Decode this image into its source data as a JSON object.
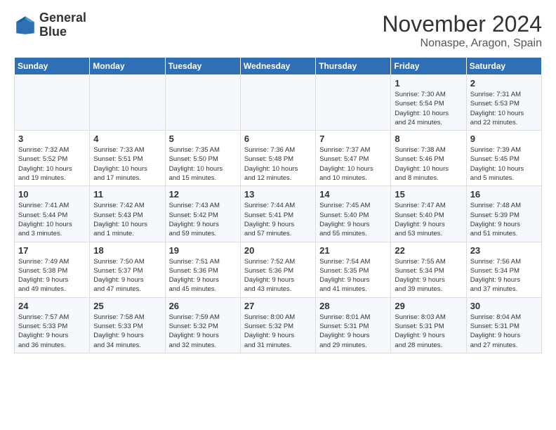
{
  "header": {
    "logo_line1": "General",
    "logo_line2": "Blue",
    "month": "November 2024",
    "location": "Nonaspe, Aragon, Spain"
  },
  "weekdays": [
    "Sunday",
    "Monday",
    "Tuesday",
    "Wednesday",
    "Thursday",
    "Friday",
    "Saturday"
  ],
  "weeks": [
    [
      {
        "day": "",
        "info": ""
      },
      {
        "day": "",
        "info": ""
      },
      {
        "day": "",
        "info": ""
      },
      {
        "day": "",
        "info": ""
      },
      {
        "day": "",
        "info": ""
      },
      {
        "day": "1",
        "info": "Sunrise: 7:30 AM\nSunset: 5:54 PM\nDaylight: 10 hours\nand 24 minutes."
      },
      {
        "day": "2",
        "info": "Sunrise: 7:31 AM\nSunset: 5:53 PM\nDaylight: 10 hours\nand 22 minutes."
      }
    ],
    [
      {
        "day": "3",
        "info": "Sunrise: 7:32 AM\nSunset: 5:52 PM\nDaylight: 10 hours\nand 19 minutes."
      },
      {
        "day": "4",
        "info": "Sunrise: 7:33 AM\nSunset: 5:51 PM\nDaylight: 10 hours\nand 17 minutes."
      },
      {
        "day": "5",
        "info": "Sunrise: 7:35 AM\nSunset: 5:50 PM\nDaylight: 10 hours\nand 15 minutes."
      },
      {
        "day": "6",
        "info": "Sunrise: 7:36 AM\nSunset: 5:48 PM\nDaylight: 10 hours\nand 12 minutes."
      },
      {
        "day": "7",
        "info": "Sunrise: 7:37 AM\nSunset: 5:47 PM\nDaylight: 10 hours\nand 10 minutes."
      },
      {
        "day": "8",
        "info": "Sunrise: 7:38 AM\nSunset: 5:46 PM\nDaylight: 10 hours\nand 8 minutes."
      },
      {
        "day": "9",
        "info": "Sunrise: 7:39 AM\nSunset: 5:45 PM\nDaylight: 10 hours\nand 5 minutes."
      }
    ],
    [
      {
        "day": "10",
        "info": "Sunrise: 7:41 AM\nSunset: 5:44 PM\nDaylight: 10 hours\nand 3 minutes."
      },
      {
        "day": "11",
        "info": "Sunrise: 7:42 AM\nSunset: 5:43 PM\nDaylight: 10 hours\nand 1 minute."
      },
      {
        "day": "12",
        "info": "Sunrise: 7:43 AM\nSunset: 5:42 PM\nDaylight: 9 hours\nand 59 minutes."
      },
      {
        "day": "13",
        "info": "Sunrise: 7:44 AM\nSunset: 5:41 PM\nDaylight: 9 hours\nand 57 minutes."
      },
      {
        "day": "14",
        "info": "Sunrise: 7:45 AM\nSunset: 5:40 PM\nDaylight: 9 hours\nand 55 minutes."
      },
      {
        "day": "15",
        "info": "Sunrise: 7:47 AM\nSunset: 5:40 PM\nDaylight: 9 hours\nand 53 minutes."
      },
      {
        "day": "16",
        "info": "Sunrise: 7:48 AM\nSunset: 5:39 PM\nDaylight: 9 hours\nand 51 minutes."
      }
    ],
    [
      {
        "day": "17",
        "info": "Sunrise: 7:49 AM\nSunset: 5:38 PM\nDaylight: 9 hours\nand 49 minutes."
      },
      {
        "day": "18",
        "info": "Sunrise: 7:50 AM\nSunset: 5:37 PM\nDaylight: 9 hours\nand 47 minutes."
      },
      {
        "day": "19",
        "info": "Sunrise: 7:51 AM\nSunset: 5:36 PM\nDaylight: 9 hours\nand 45 minutes."
      },
      {
        "day": "20",
        "info": "Sunrise: 7:52 AM\nSunset: 5:36 PM\nDaylight: 9 hours\nand 43 minutes."
      },
      {
        "day": "21",
        "info": "Sunrise: 7:54 AM\nSunset: 5:35 PM\nDaylight: 9 hours\nand 41 minutes."
      },
      {
        "day": "22",
        "info": "Sunrise: 7:55 AM\nSunset: 5:34 PM\nDaylight: 9 hours\nand 39 minutes."
      },
      {
        "day": "23",
        "info": "Sunrise: 7:56 AM\nSunset: 5:34 PM\nDaylight: 9 hours\nand 37 minutes."
      }
    ],
    [
      {
        "day": "24",
        "info": "Sunrise: 7:57 AM\nSunset: 5:33 PM\nDaylight: 9 hours\nand 36 minutes."
      },
      {
        "day": "25",
        "info": "Sunrise: 7:58 AM\nSunset: 5:33 PM\nDaylight: 9 hours\nand 34 minutes."
      },
      {
        "day": "26",
        "info": "Sunrise: 7:59 AM\nSunset: 5:32 PM\nDaylight: 9 hours\nand 32 minutes."
      },
      {
        "day": "27",
        "info": "Sunrise: 8:00 AM\nSunset: 5:32 PM\nDaylight: 9 hours\nand 31 minutes."
      },
      {
        "day": "28",
        "info": "Sunrise: 8:01 AM\nSunset: 5:31 PM\nDaylight: 9 hours\nand 29 minutes."
      },
      {
        "day": "29",
        "info": "Sunrise: 8:03 AM\nSunset: 5:31 PM\nDaylight: 9 hours\nand 28 minutes."
      },
      {
        "day": "30",
        "info": "Sunrise: 8:04 AM\nSunset: 5:31 PM\nDaylight: 9 hours\nand 27 minutes."
      }
    ]
  ]
}
